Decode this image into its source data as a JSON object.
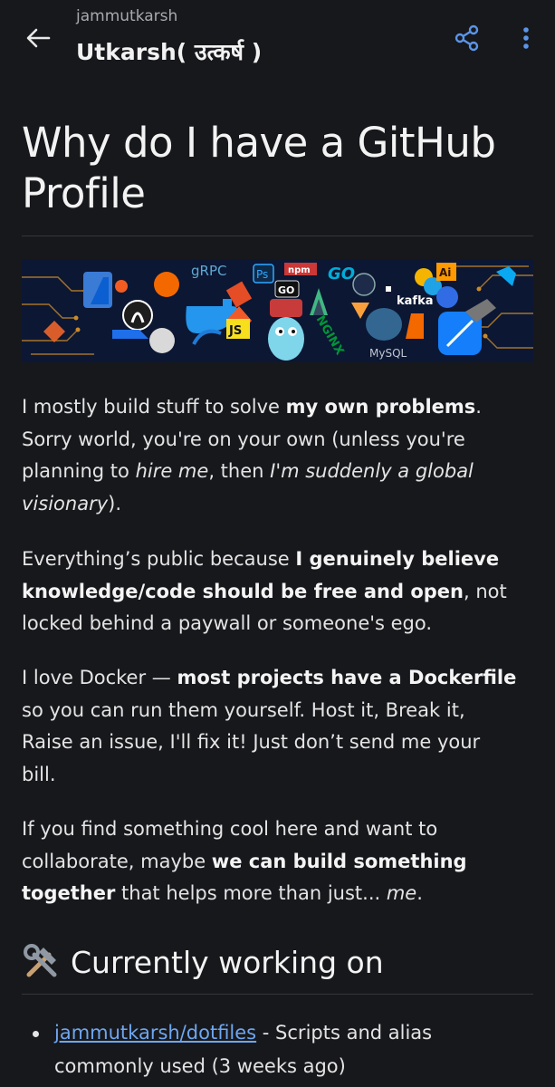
{
  "appbar": {
    "subtitle": "jammutkarsh",
    "title": "Utkarsh( उत्कर्ष )",
    "back_icon": "arrow-left-icon",
    "share_icon": "share-icon",
    "more_icon": "more-vert-icon"
  },
  "readme": {
    "title": "Why do I have a GitHub Profile",
    "banner": {
      "labels": [
        "gRPC",
        "Ps",
        "npm",
        "GO",
        "GO",
        "kafka",
        "NGINX",
        "JS",
        "MySQL",
        "Ai"
      ]
    },
    "p1": {
      "t1": "I mostly build stuff to solve ",
      "b1": "my own problems",
      "t2": ". Sorry world, you're on your own (unless you're planning to ",
      "i1": "hire me",
      "t3": ", then ",
      "i2": "I'm suddenly a global visionary",
      "t4": ")."
    },
    "p2": {
      "t1": "Everything’s public because ",
      "b1": "I genuinely believe knowledge/code should be free and open",
      "t2": ", not locked behind a paywall or someone's ego."
    },
    "p3": {
      "t1": "I love Docker — ",
      "b1": "most projects have a Dockerfile",
      "t2": " so you can run them yourself. Host it, Break it, Raise an issue, I'll fix it! Just don’t send me your bill."
    },
    "p4": {
      "t1": "If you find something cool here and want to collaborate, maybe ",
      "b1": "we can build something together",
      "t2": " that helps more than just... ",
      "i1": "me",
      "t3": "."
    },
    "section_heading": "Currently working on",
    "section_emoji": "hammer-and-wrench",
    "list": [
      {
        "link": "jammutkarsh/dotfiles",
        "text": " - Scripts and alias commonly used (3 weeks ago)"
      }
    ]
  },
  "colors": {
    "background": "#17181c",
    "text": "#e4e4e4",
    "muted": "#a7a9ae",
    "link": "#6ea6f0",
    "accent": "#5b95e8"
  }
}
